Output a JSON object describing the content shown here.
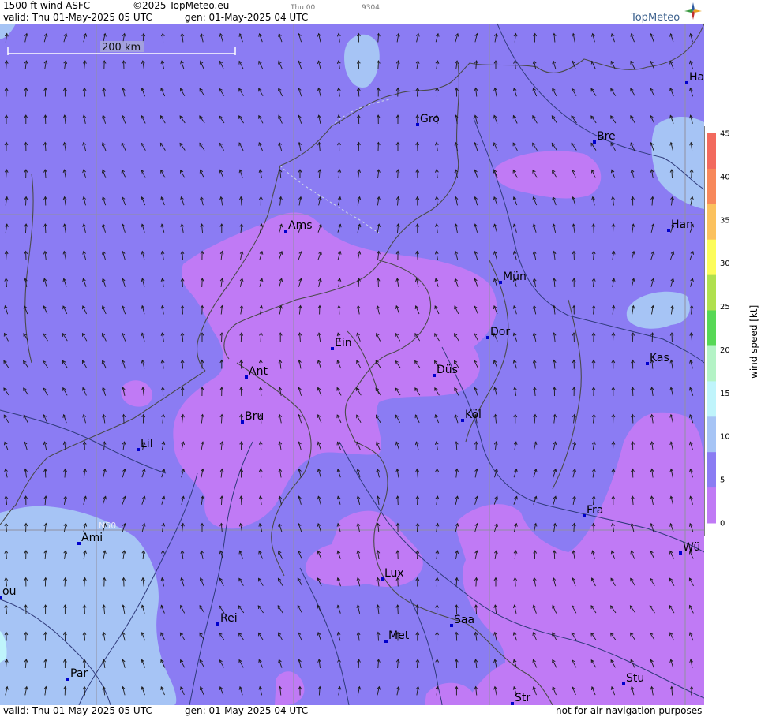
{
  "header": {
    "product": "1500 ft wind ASFC",
    "copyright": "©2025 TopMeteo.eu",
    "small_label": "Thu 00",
    "small_code": "9304",
    "valid": "valid:  Thu  01-May-2025  05 UTC",
    "gen": "gen: 01-May-2025 04 UTC",
    "brand": "TopMeteo"
  },
  "footer": {
    "valid": "valid:  Thu  01-May-2025  05 UTC",
    "gen": "gen: 01-May-2025 04 UTC",
    "disclaimer": "not for air navigation purposes"
  },
  "scale_bar": {
    "label": "200 km"
  },
  "grid_label": "N50",
  "cities": [
    "Gro",
    "Bre",
    "Ha",
    "Ams",
    "Han",
    "Mün",
    "Ein",
    "Dor",
    "Ant",
    "Düs",
    "Kas",
    "Bru",
    "Köl",
    "Lil",
    "Fra",
    "Ami",
    "Wü",
    "Lux",
    "ou",
    "Rei",
    "Saa",
    "Met",
    "Par",
    "Stu",
    "Str"
  ],
  "legend": {
    "title": "wind  speed  [kt]",
    "ticks": [
      "0",
      "5",
      "10",
      "15",
      "20",
      "25",
      "30",
      "35",
      "40",
      "45"
    ],
    "colors": [
      "#c07af5",
      "#8b7cf3",
      "#a6c4f5",
      "#bff4fb",
      "#b4f3c6",
      "#57d856",
      "#b0e04e",
      "#fcfc5a",
      "#fbc15e",
      "#f7885b",
      "#f26a5e"
    ]
  },
  "colors": {
    "speed_0_5": "#c07af5",
    "speed_5_10": "#8b7cf3",
    "speed_10_15": "#a6c4f5",
    "city_marker": "#0000cc",
    "arrow": "#1a1a1a"
  }
}
